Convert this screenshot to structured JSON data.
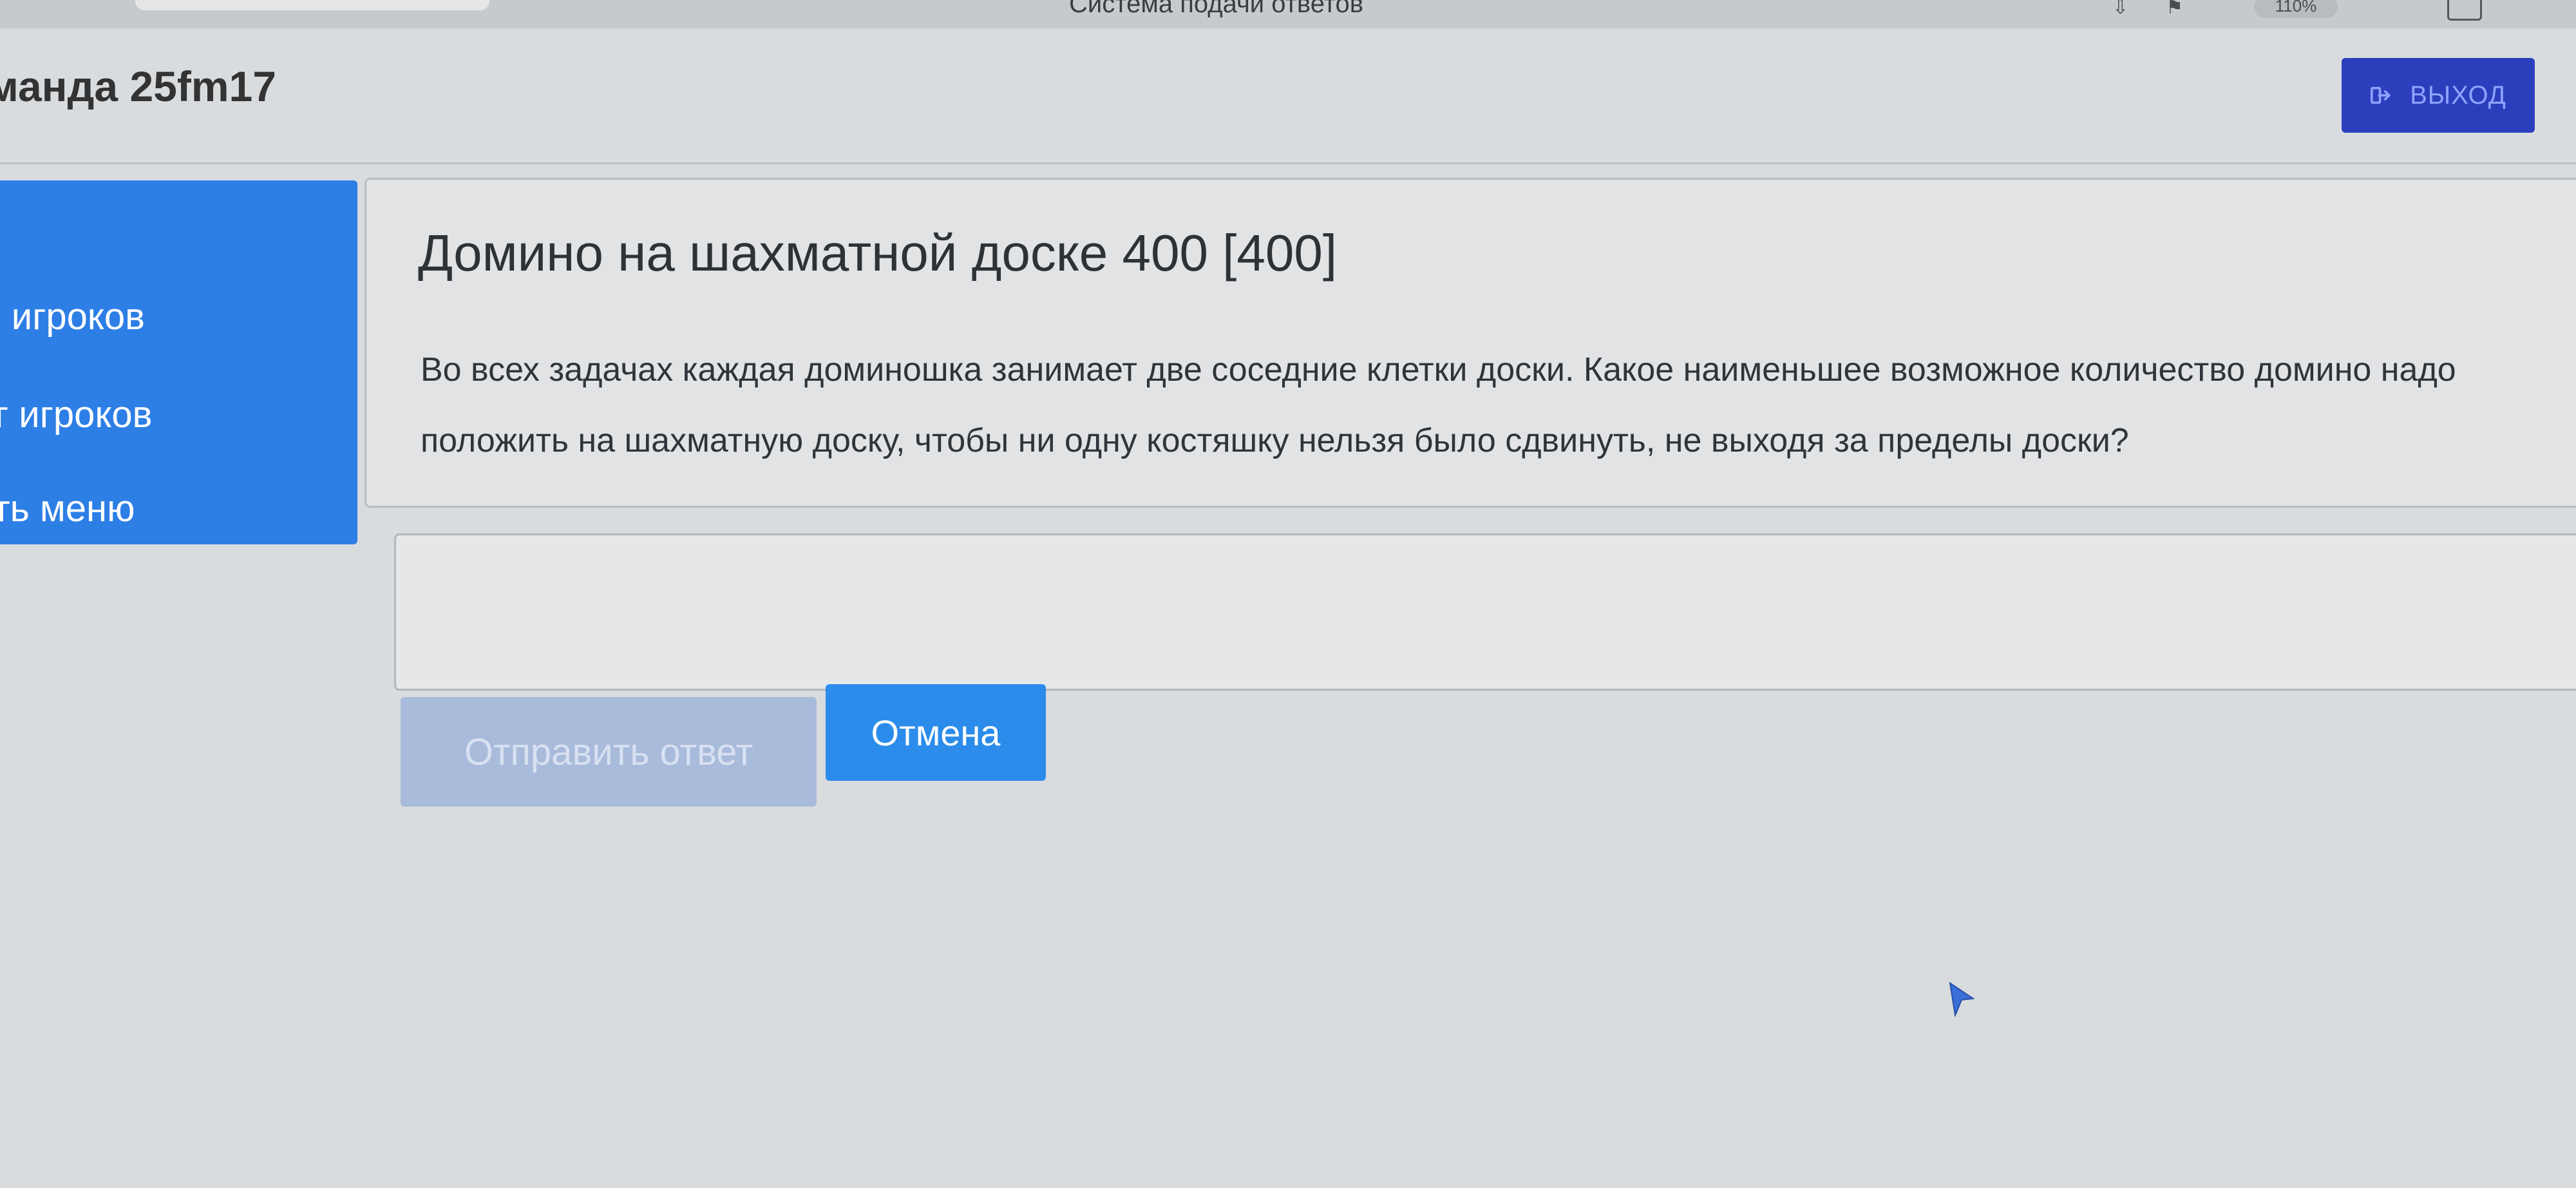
{
  "browser": {
    "title": "Система подачи ответов",
    "icons": [
      "download-icon",
      "bookmark-icon",
      "zoom-icon",
      "menu-icon",
      "tabs-icon"
    ],
    "zoom_level": "110%"
  },
  "header": {
    "team_name": "манда 25fm17",
    "logout_label": "выход"
  },
  "sidebar": {
    "items": [
      {
        "label": "ы игроков"
      },
      {
        "label": "нг игроков"
      },
      {
        "label": "уть меню"
      }
    ]
  },
  "task": {
    "title": "Домино на шахматной доске 400 [400]",
    "text": "Во всех задачах каждая доминошка занимает две соседние клетки доски. Какое наименьшее возможное количество домино надо положить на шахматную доску, чтобы ни одну костяшку нельзя было сдвинуть, не выходя за пределы доски?"
  },
  "answer": {
    "value": "",
    "placeholder": ""
  },
  "actions": {
    "submit_label": "Отправить ответ",
    "cancel_label": "Отмена"
  },
  "colors": {
    "accent_blue": "#2d7fe6",
    "logout_blue": "#2b3fbd",
    "submit_disabled": "#a9bbdb",
    "page_background": "#d9dcdf"
  }
}
